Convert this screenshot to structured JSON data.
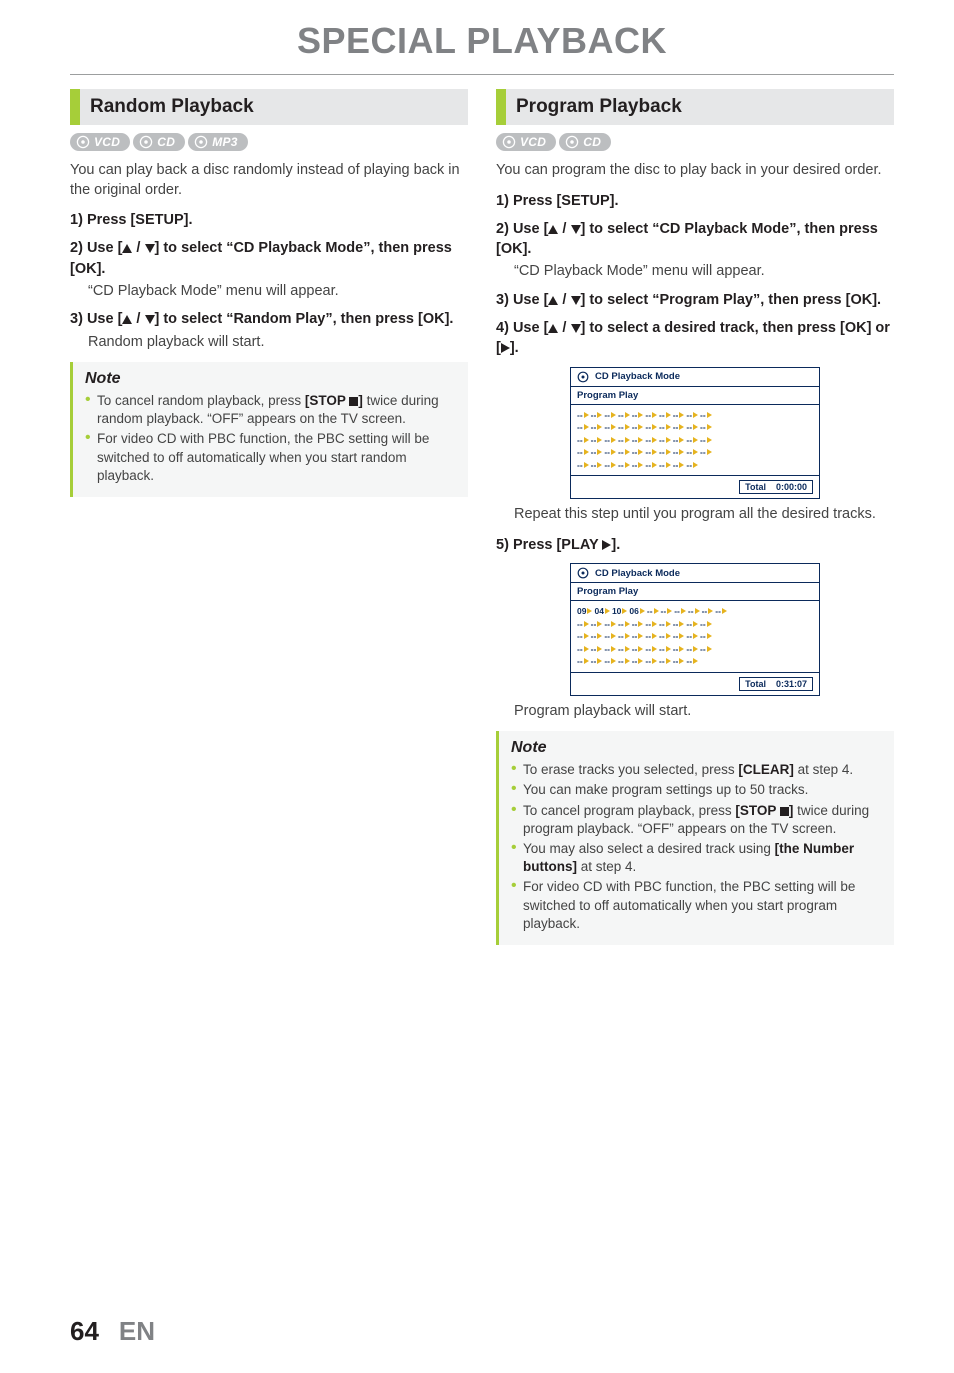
{
  "page_title": "SPECIAL PLAYBACK",
  "footer": {
    "page_number": "64",
    "language": "EN"
  },
  "left": {
    "heading": "Random Playback",
    "badges": [
      "VCD",
      "CD",
      "MP3"
    ],
    "intro": "You can play back a disc randomly instead of playing back in the original order.",
    "steps": {
      "s1_num": "1)",
      "s1_main": "Press [SETUP].",
      "s2_num": "2)",
      "s2_main_a": "Use [",
      "s2_main_b": " / ",
      "s2_main_c": "] to select “CD Playback Mode”, then press [OK].",
      "s2_sub": "“CD Playback Mode” menu will appear.",
      "s3_num": "3)",
      "s3_main_a": "Use [",
      "s3_main_b": " / ",
      "s3_main_c": "] to select “Random Play”, then press [OK].",
      "s3_sub": "Random playback will start."
    },
    "note_title": "Note",
    "notes": {
      "n1_a": "To cancel random playback, press ",
      "n1_b": "[STOP ",
      "n1_c": "]",
      "n1_d": " twice during random playback. “OFF” appears on the TV screen.",
      "n2": "For video CD with PBC function, the PBC setting will be switched to off automatically when you start random playback."
    }
  },
  "right": {
    "heading": "Program Playback",
    "badges": [
      "VCD",
      "CD"
    ],
    "intro": "You can program the disc to play back in your desired order.",
    "steps": {
      "s1_num": "1)",
      "s1_main": "Press [SETUP].",
      "s2_num": "2)",
      "s2_main_a": "Use [",
      "s2_main_b": " / ",
      "s2_main_c": "] to select “CD Playback Mode”, then press [OK].",
      "s2_sub": "“CD Playback Mode” menu will appear.",
      "s3_num": "3)",
      "s3_main_a": "Use [",
      "s3_main_b": " / ",
      "s3_main_c": "] to select “Program Play”, then press [OK].",
      "s4_num": "4)",
      "s4_main_a": "Use [",
      "s4_main_b": " / ",
      "s4_main_c": "] to select a desired track, then press [OK] or [",
      "s4_main_d": "].",
      "s4_after": "Repeat this step until you program all the desired tracks.",
      "s5_num": "5)",
      "s5_main_a": "Press [PLAY ",
      "s5_main_b": "].",
      "s5_after": "Program playback will start."
    },
    "osd": {
      "title": "CD Playback Mode",
      "subtitle": "Program Play",
      "total_label": "Total",
      "time1": "0:00:00",
      "time2": "0:31:07",
      "prog_cells": [
        "09",
        "04",
        "10",
        "06"
      ]
    },
    "note_title": "Note",
    "notes": {
      "n1_a": "To erase tracks you selected, press ",
      "n1_b": "[CLEAR]",
      "n1_c": " at step 4.",
      "n2": "You can make program settings up to 50 tracks.",
      "n3_a": "To cancel program playback, press ",
      "n3_b": "[STOP ",
      "n3_c": "]",
      "n3_d": " twice during program playback. “OFF” appears on the TV screen.",
      "n4_a": "You may also select a desired track using ",
      "n4_b": "[the Number buttons]",
      "n4_c": " at step 4.",
      "n5": "For video CD with PBC function, the PBC setting will be switched to off automatically when you start program playback."
    }
  }
}
